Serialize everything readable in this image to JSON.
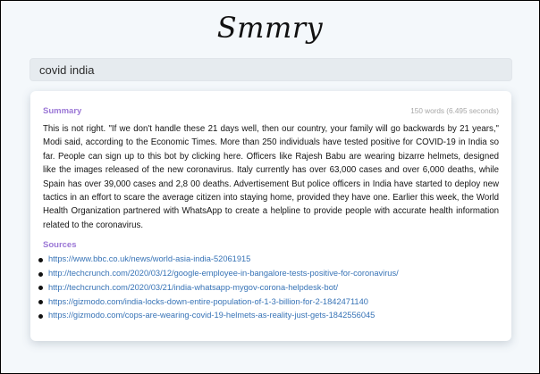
{
  "app": {
    "logo": "Smmry"
  },
  "search": {
    "value": "covid india"
  },
  "summary": {
    "label": "Summary",
    "stats": "150 words (6.495 seconds)",
    "text": "This is not right. \"If we don't handle these 21 days well, then our country, your family will go backwards by 21 years,\" Modi said, according to the Economic Times. More than 250 individuals have tested positive for COVID-19 in India so far. People can sign up to this bot by clicking here. Officers like Rajesh Babu are wearing bizarre helmets, designed like the images released of the new coronavirus. Italy currently has over 63,000 cases and over 6,000 deaths, while Spain has over 39,000 cases and 2,8 00 deaths. Advertisement But police officers in India have started to deploy new tactics in an effort to scare the average citizen into staying home, provided they have one. Earlier this week, the World Health Organization partnered with WhatsApp to create a helpline to provide people with accurate health information related to the coronavirus."
  },
  "sources": {
    "label": "Sources",
    "items": [
      "https://www.bbc.co.uk/news/world-asia-india-52061915",
      "http://techcrunch.com/2020/03/12/google-employee-in-bangalore-tests-positive-for-coronavirus/",
      "http://techcrunch.com/2020/03/21/india-whatsapp-mygov-corona-helpdesk-bot/",
      "https://gizmodo.com/india-locks-down-entire-population-of-1-3-billion-for-2-1842471140",
      "https://gizmodo.com/cops-are-wearing-covid-19-helmets-as-reality-just-gets-1842556045"
    ]
  },
  "colors": {
    "accent": "#9b77d6",
    "link": "#3773b6",
    "background": "#f4f8fb"
  }
}
